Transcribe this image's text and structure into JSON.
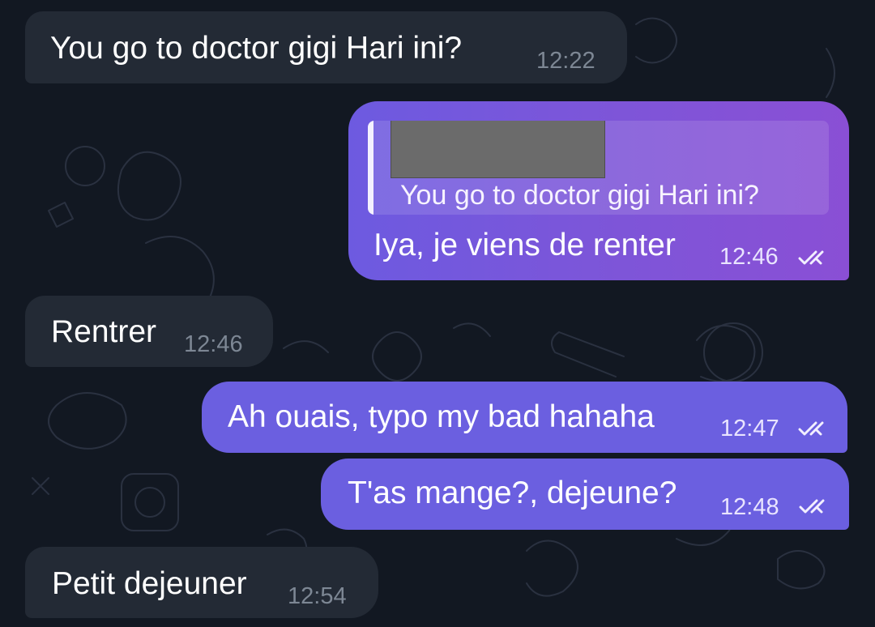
{
  "messages": [
    {
      "text": "You go to doctor gigi Hari ini?",
      "time": "12:22"
    },
    {
      "reply": {
        "text": "You go to doctor gigi Hari ini?"
      },
      "text": "Iya, je viens de renter",
      "time": "12:46",
      "status": "read-double-check-icon"
    },
    {
      "text": "Rentrer",
      "time": "12:46"
    },
    {
      "text": "Ah ouais, typo my bad hahaha",
      "time": "12:47",
      "status": "read-double-check-icon"
    },
    {
      "text": "T'as mange?, dejeune?",
      "time": "12:48",
      "status": "read-double-check-icon"
    },
    {
      "text": "Petit dejeuner",
      "time": "12:54"
    }
  ],
  "colors": {
    "background": "#121822",
    "incoming_bubble": "#232a35",
    "outgoing_bubble_gradient_start": "#6d5ae0",
    "outgoing_bubble_gradient_end": "#8a4fd5",
    "outgoing_bubble_plain": "#6b5fe0"
  }
}
